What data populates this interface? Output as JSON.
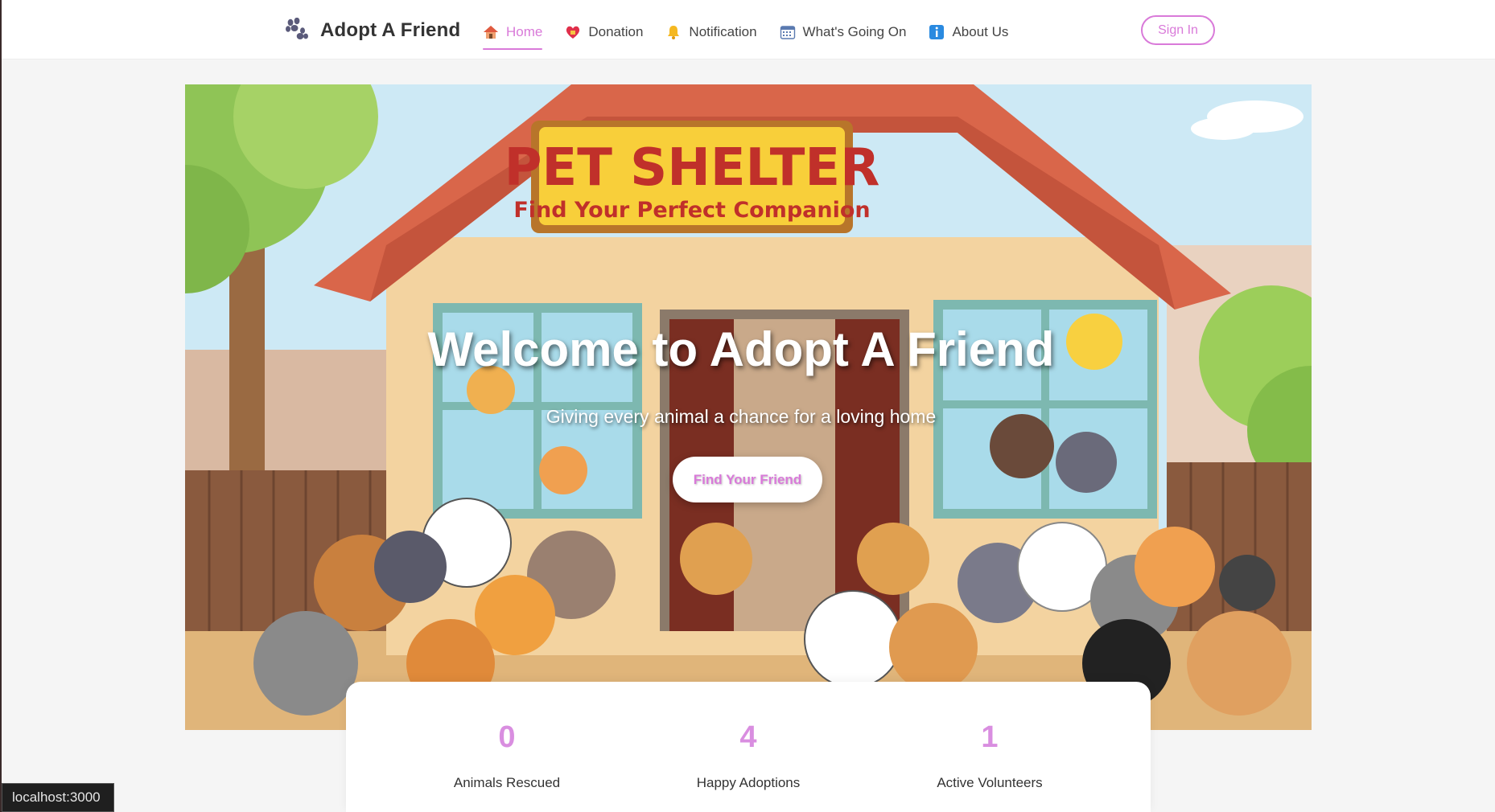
{
  "header": {
    "brand": "Adopt A Friend",
    "nav": [
      {
        "label": "Home",
        "icon": "home-icon",
        "active": true
      },
      {
        "label": "Donation",
        "icon": "heart-gift-icon",
        "active": false
      },
      {
        "label": "Notification",
        "icon": "bell-icon",
        "active": false
      },
      {
        "label": "What's Going On",
        "icon": "calendar-icon",
        "active": false
      },
      {
        "label": "About Us",
        "icon": "info-icon",
        "active": false
      }
    ],
    "signin_label": "Sign In"
  },
  "hero": {
    "sign_title": "PET SHELTER",
    "sign_subtitle": "Find Your Perfect Companion",
    "title": "Welcome to Adopt A Friend",
    "subtitle": "Giving every animal a chance for a loving home",
    "cta_label": "Find Your Friend"
  },
  "stats": [
    {
      "value": "0",
      "label": "Animals Rescued"
    },
    {
      "value": "4",
      "label": "Happy Adoptions"
    },
    {
      "value": "1",
      "label": "Active Volunteers"
    }
  ],
  "status_bar": {
    "url": "localhost:3000"
  },
  "colors": {
    "accent": "#d97ad9",
    "stat_number": "#d98ee0",
    "page_bg": "#f5f5f5"
  }
}
